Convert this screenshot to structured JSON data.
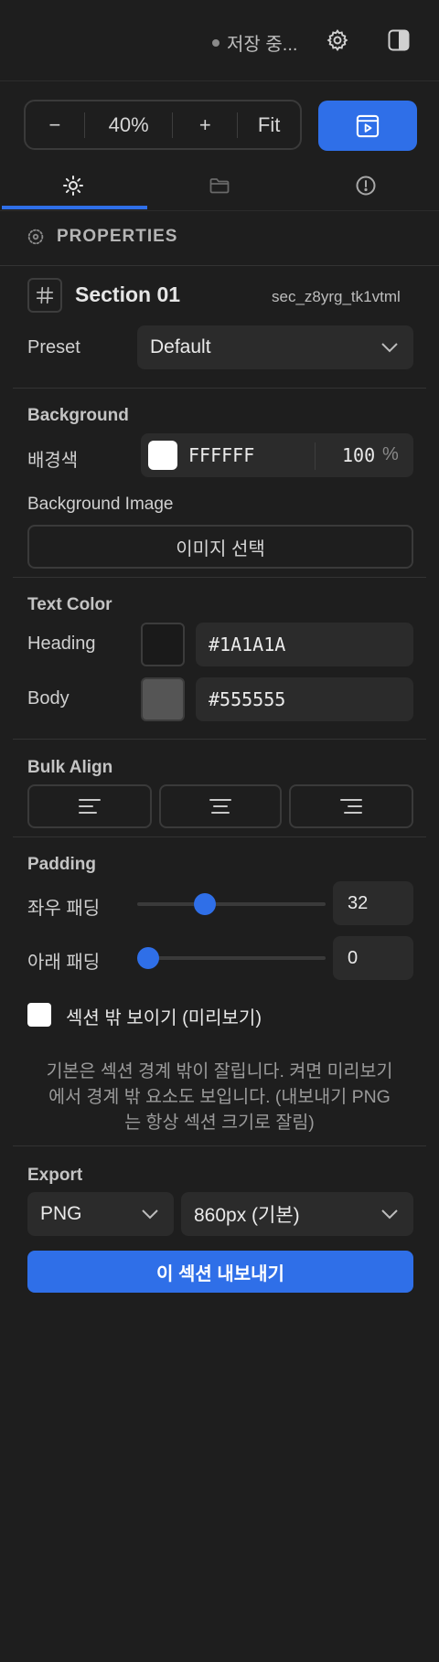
{
  "header": {
    "save_status": "저장 중...",
    "settings_icon": "gear-icon",
    "panel_icon": "panel-toggle-icon"
  },
  "zoom": {
    "minus": "−",
    "value": "40%",
    "plus": "+",
    "fit": "Fit",
    "preview_icon": "play-preview-icon"
  },
  "tabs": [
    {
      "icon": "sun-settings-icon",
      "active": true
    },
    {
      "icon": "folder-icon",
      "active": false
    },
    {
      "icon": "alert-circle-icon",
      "active": false
    }
  ],
  "properties": {
    "title": "PROPERTIES",
    "section_name": "Section 01",
    "section_id": "sec_z8yrg_tk1vtml",
    "preset_label": "Preset",
    "preset_value": "Default"
  },
  "background": {
    "title": "Background",
    "color_label": "배경색",
    "color_hex": "FFFFFF",
    "opacity": "100",
    "opacity_unit": "%",
    "image_label": "Background Image",
    "image_button": "이미지 선택",
    "swatch_color": "#FFFFFF"
  },
  "text_color": {
    "title": "Text Color",
    "heading_label": "Heading",
    "heading_hex": "#1A1A1A",
    "body_label": "Body",
    "body_hex": "#555555"
  },
  "bulk_align": {
    "title": "Bulk Align",
    "options": [
      "align-left-icon",
      "align-center-icon",
      "align-right-icon"
    ]
  },
  "padding": {
    "title": "Padding",
    "horizontal_label": "좌우 패딩",
    "horizontal_value": "32",
    "horizontal_level": 0.34,
    "bottom_label": "아래 패딩",
    "bottom_value": "0",
    "bottom_level": 0.0,
    "checkbox_label": "섹션 밖 보이기 (미리보기)",
    "checkbox_checked": false,
    "note": "기본은 섹션 경계 밖이 잘립니다. 켜면 미리보기에서 경계 밖 요소도 보입니다. (내보내기 PNG는 항상 섹션 크기로 잘림)"
  },
  "export": {
    "title": "Export",
    "format": "PNG",
    "size": "860px (기본)",
    "button": "이 섹션 내보내기"
  },
  "colors": {
    "accent": "#2F6FE8",
    "background": "#1E1E1E",
    "field": "#2B2B2B"
  }
}
